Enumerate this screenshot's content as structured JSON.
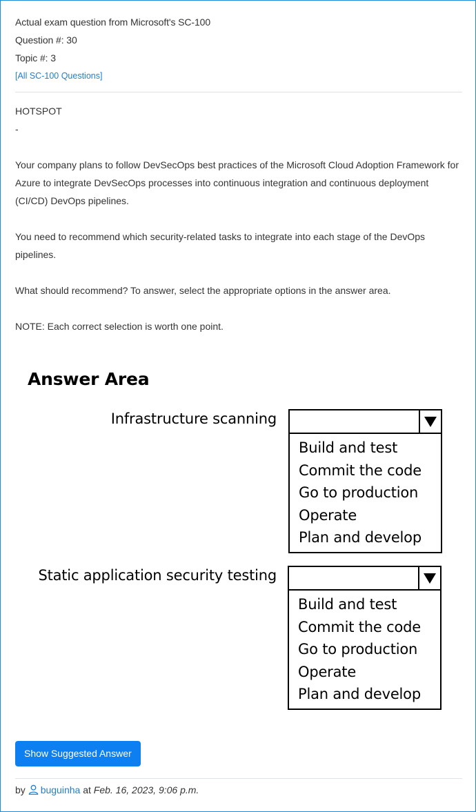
{
  "header": {
    "exam_line": "Actual exam question from Microsoft's SC-100",
    "question_num": "Question #: 30",
    "topic_num": "Topic #: 3",
    "all_questions_link": "[All SC-100 Questions]"
  },
  "question": {
    "type": "HOTSPOT",
    "dash": "-",
    "para1": "Your company plans to follow DevSecOps best practices of the Microsoft Cloud Adoption Framework for Azure to integrate DevSecOps processes into continuous integration and continuous deployment (CI/CD) DevOps pipelines.",
    "para2": "You need to recommend which security-related tasks to integrate into each stage of the DevOps pipelines.",
    "para3": "What should recommend? To answer, select the appropriate options in the answer area.",
    "para4": "NOTE: Each correct selection is worth one point."
  },
  "answer_area": {
    "title": "Answer Area",
    "rows": [
      {
        "label": "Infrastructure scanning",
        "options": [
          "Build and test",
          "Commit the code",
          "Go to production",
          "Operate",
          "Plan and develop"
        ]
      },
      {
        "label": "Static application security testing",
        "options": [
          "Build and test",
          "Commit the code",
          "Go to production",
          "Operate",
          "Plan and develop"
        ]
      }
    ]
  },
  "actions": {
    "show_answer_label": "Show Suggested Answer"
  },
  "footer": {
    "by": "by",
    "username": "buguinha",
    "at": "at",
    "date": "Feb. 16, 2023, 9:06 p.m."
  }
}
